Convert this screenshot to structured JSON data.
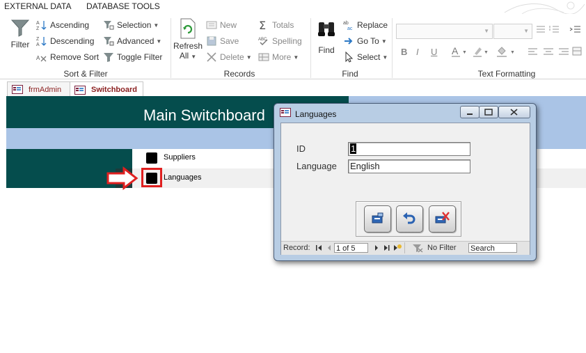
{
  "menu": {
    "external_data": "EXTERNAL DATA",
    "database_tools": "DATABASE TOOLS"
  },
  "ribbon": {
    "filter": "Filter",
    "ascending": "Ascending",
    "descending": "Descending",
    "remove_sort": "Remove Sort",
    "selection": "Selection",
    "advanced": "Advanced",
    "toggle_filter": "Toggle Filter",
    "sort_filter_group": "Sort & Filter",
    "refresh_line1": "Refresh",
    "refresh_line2": "All",
    "new": "New",
    "save": "Save",
    "delete": "Delete",
    "totals": "Totals",
    "spelling": "Spelling",
    "more": "More",
    "records_group": "Records",
    "find": "Find",
    "replace": "Replace",
    "go_to": "Go To",
    "select": "Select",
    "find_group": "Find",
    "bold": "B",
    "italic": "I",
    "underline": "U",
    "text_formatting_group": "Text Formatting"
  },
  "doc_tabs": {
    "frm_admin": "frmAdmin",
    "switchboard": "Switchboard"
  },
  "switchboard": {
    "title": "Main Switchboard",
    "items": [
      "Suppliers",
      "Languages"
    ]
  },
  "dialog": {
    "title": "Languages",
    "id_label": "ID",
    "id_value": "1",
    "language_label": "Language",
    "language_value": "English"
  },
  "navbar": {
    "record_label": "Record:",
    "position": "1 of 5",
    "no_filter": "No Filter",
    "search_placeholder": "Search"
  },
  "icons": [
    "filter-icon",
    "sort-ascending-icon",
    "sort-descending-icon",
    "remove-sort-icon",
    "selection-icon",
    "advanced-filter-icon",
    "toggle-filter-icon",
    "refresh-icon",
    "new-record-icon",
    "save-icon",
    "delete-icon",
    "totals-icon",
    "spelling-icon",
    "more-icon",
    "binoculars-icon",
    "replace-icon",
    "goto-arrow-icon",
    "select-cursor-icon",
    "add-record-icon",
    "undo-icon",
    "delete-record-icon",
    "red-arrow-icon"
  ],
  "colors": {
    "switchboard_header": "#054d4d",
    "switchboard_band": "#aac4e6",
    "highlight_red": "#e02020",
    "tab_text": "#8b2020"
  }
}
